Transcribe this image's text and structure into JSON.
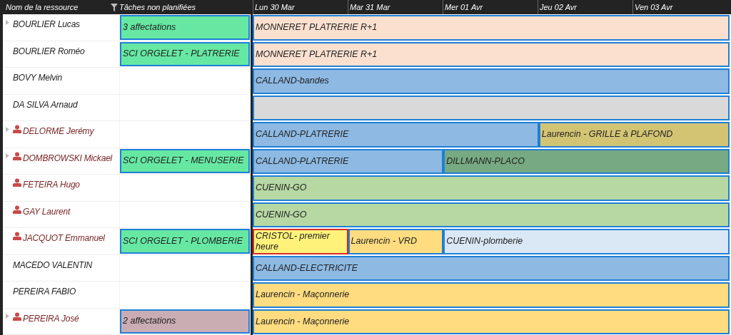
{
  "header": {
    "resource_column": "Nom de la ressource",
    "unplanned_column": "Tâches non planifiées",
    "days": [
      "Lun 30 Mar",
      "Mar 31 Mar",
      "Mer 01 Avr",
      "Jeu 02 Avr",
      "Ven 03 Avr"
    ]
  },
  "rows": [
    {
      "name": "BOURLIER Lucas",
      "kind": "plain",
      "expandable": true,
      "unplanned": {
        "label": "3 affectations",
        "color": "#66e8a3"
      },
      "events": [
        {
          "label": "MONNERET PLATRERIE R+1",
          "color": "#fbe0cf",
          "level": 1,
          "flagged": false
        }
      ]
    },
    {
      "name": "BOURLIER Roméo",
      "kind": "plain",
      "expandable": false,
      "unplanned": {
        "label": "SCI ORGELET - PLATRERIE",
        "color": "#66e8a3"
      },
      "events": [
        {
          "label": "MONNERET PLATRERIE R+1",
          "color": "#fbe0cf",
          "level": 1,
          "flagged": false
        }
      ]
    },
    {
      "name": "BOVY Melvin",
      "kind": "plain",
      "expandable": false,
      "events": [
        {
          "label": "CALLAND-bandes",
          "color": "#8db9e2",
          "level": 1,
          "flagged": false
        }
      ]
    },
    {
      "name": "DA SILVA Arnaud",
      "kind": "plain",
      "expandable": false,
      "events": [
        {
          "color": "#d9d9d9",
          "level": 1,
          "flagged": false
        }
      ]
    },
    {
      "name": "DELORME Jerémy",
      "kind": "person",
      "expandable": true,
      "events": [
        {
          "label": "CALLAND-PLATRERIE",
          "color": "#8db9e2",
          "level": 0.6,
          "flagged": false
        },
        {
          "label": "Laurencin - GRILLE à PLAFOND",
          "color": "#d3c474",
          "level": 0.4,
          "flagged": false
        }
      ]
    },
    {
      "name": "DOMBROWSKI Mickael",
      "kind": "person",
      "expandable": true,
      "unplanned": {
        "label": "SCI ORGELET - MENUSERIE",
        "color": "#66e8a3"
      },
      "events": [
        {
          "label": "CALLAND-PLATRERIE",
          "color": "#8db9e2",
          "level": 0.4,
          "flagged": false
        },
        {
          "label": "DILLMANN-PLACO",
          "color": "#77a982",
          "level": 0.6,
          "flagged": false
        }
      ]
    },
    {
      "name": "FETEIRA Hugo",
      "kind": "person",
      "expandable": false,
      "events": [
        {
          "label": "CUENIN-GO",
          "color": "#b7d8a3",
          "level": 1,
          "flagged": false
        }
      ]
    },
    {
      "name": "GAY Laurent",
      "kind": "person",
      "expandable": false,
      "events": [
        {
          "label": "CUENIN-GO",
          "color": "#b7d8a3",
          "level": 1,
          "flagged": false
        }
      ]
    },
    {
      "name": "JACQUOT Emmanuel",
      "kind": "person",
      "expandable": false,
      "unplanned": {
        "label": "SCI ORGELET - PLOMBERIE",
        "color": "#66e8a3"
      },
      "events": [
        {
          "label": "CRISTOL- premier heure",
          "color": "#fff27a",
          "level": 0.2,
          "flagged": true
        },
        {
          "label": "Laurencin - VRD",
          "color": "#ffdc7f",
          "level": 0.2,
          "flagged": false
        },
        {
          "label": "CUENIN-plomberie",
          "color": "#dae7f5",
          "level": 0.6,
          "flagged": false
        }
      ]
    },
    {
      "name": "MACEDO VALENTIN",
      "kind": "plain",
      "expandable": false,
      "events": [
        {
          "label": "CALLAND-ELECTRICITE",
          "color": "#8db9e2",
          "level": 1,
          "flagged": false
        }
      ]
    },
    {
      "name": "PEREIRA FABIO",
      "kind": "plain",
      "expandable": false,
      "events": [
        {
          "label": "Laurencin - Maçonnerie",
          "color": "#ffdc7f",
          "level": 1,
          "flagged": false
        }
      ]
    },
    {
      "name": "PEREIRA José",
      "kind": "person",
      "expandable": true,
      "unplanned": {
        "label": "2 affectations",
        "color": "#c9adb3"
      },
      "events": [
        {
          "label": "Laurencin - Maçonnerie",
          "color": "#ffdc7f",
          "level": 1,
          "flagged": false
        }
      ]
    }
  ]
}
